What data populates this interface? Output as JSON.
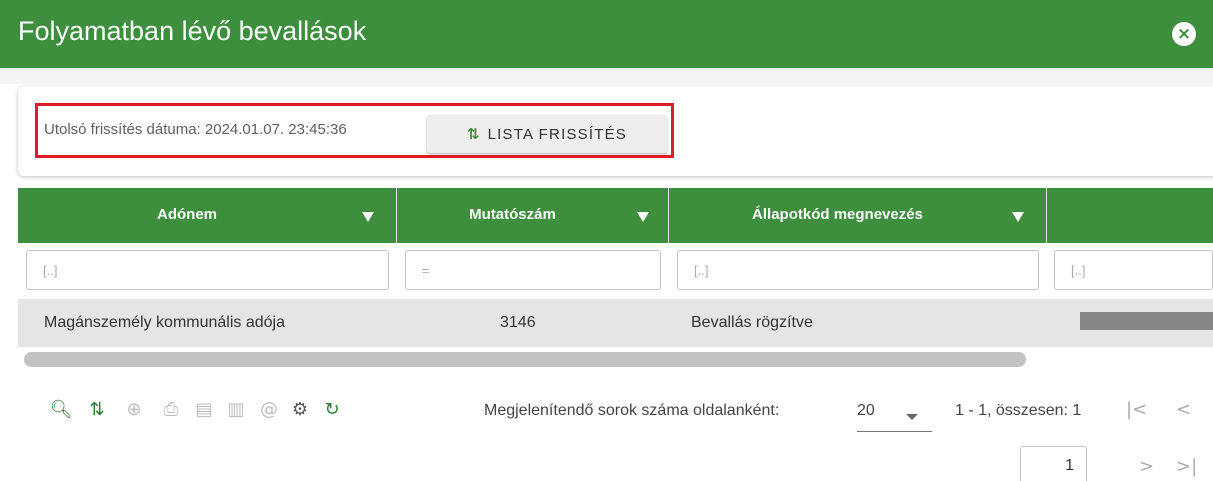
{
  "window": {
    "title": "Folyamatban lévő bevallások",
    "close_icon": "×"
  },
  "colors": {
    "header_green": "#3d8f3e",
    "highlight_red": "#e01d24"
  },
  "refresh_panel": {
    "last_update_label": "Utolsó frissítés dátuma: 2024.01.07. 23:45:36",
    "refresh_icon": "refresh-icon",
    "refresh_button_label": "LISTA FRISSÍTÉS"
  },
  "grid": {
    "columns": [
      {
        "label": "Adónem",
        "filter_placeholder": "[..]"
      },
      {
        "label": "Mutatószám",
        "filter_placeholder": "="
      },
      {
        "label": "Állapotkód megnevezés",
        "filter_placeholder": "[..]"
      },
      {
        "label": "",
        "filter_placeholder": "[..]"
      }
    ],
    "rows": [
      {
        "adonem": "Magánszemély kommunális adója",
        "mutatoszam": "3146",
        "allapot": "Bevallás rögzítve"
      }
    ]
  },
  "toolbar": {
    "icons": [
      "search-icon",
      "refresh-icon",
      "add-icon",
      "print-icon",
      "document-icon",
      "excel-icon",
      "email-icon",
      "settings-icon",
      "reload-icon"
    ]
  },
  "pager": {
    "rows_per_page_label": "Megjelenítendő sorok száma oldalanként:",
    "rows_per_page_value": "20",
    "range_label": "1 - 1, összesen: 1",
    "current_page": "1"
  }
}
